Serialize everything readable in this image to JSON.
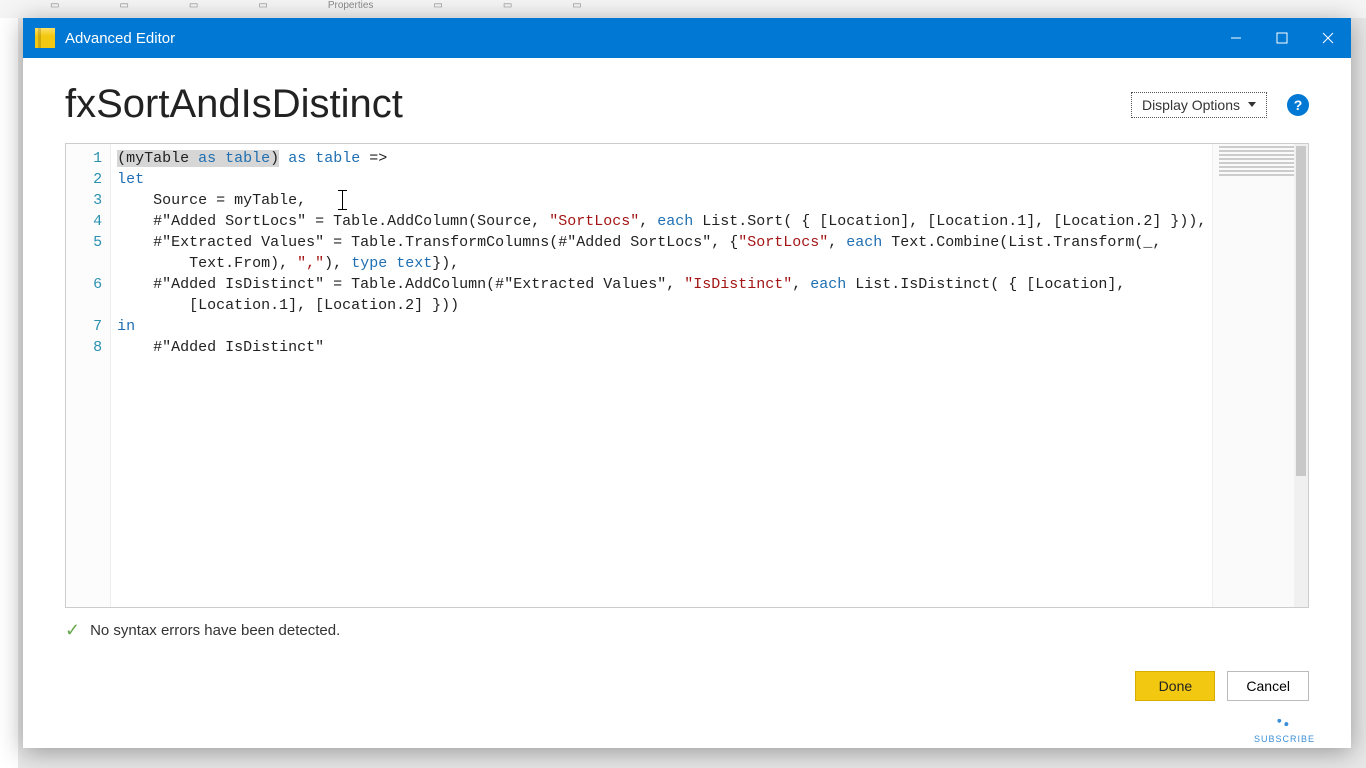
{
  "titlebar": {
    "title": "Advanced Editor"
  },
  "header": {
    "query_name": "fxSortAndIsDistinct",
    "display_options_label": "Display Options"
  },
  "editor": {
    "line_numbers": [
      "1",
      "2",
      "3",
      "4",
      "5",
      "6",
      "7",
      "8"
    ],
    "code": {
      "l1_a": "(myTable ",
      "l1_b": "as",
      "l1_c": " table",
      "l1_d": ")",
      "l1_e": " ",
      "l1_f": "as",
      "l1_g": " table",
      "l1_h": " =>",
      "l2_a": "let",
      "l3": "    Source = myTable,",
      "l4_a": "    #\"Added SortLocs\" = Table.AddColumn(Source, ",
      "l4_b": "\"SortLocs\"",
      "l4_c": ", ",
      "l4_d": "each",
      "l4_e": " List.Sort( { [Location], [Location.1], [Location.2] })),",
      "l5_a": "    #\"Extracted Values\" = Table.TransformColumns(#\"Added SortLocs\", {",
      "l5_b": "\"SortLocs\"",
      "l5_c": ", ",
      "l5_d": "each",
      "l5_e": " Text.Combine(List.Transform(_,",
      "l5f": "        Text.From), ",
      "l5g": "\",\"",
      "l5h": "), ",
      "l5i": "type",
      "l5j": " text",
      "l5k": "}),",
      "l6_a": "    #\"Added IsDistinct\" = Table.AddColumn(#\"Extracted Values\", ",
      "l6_b": "\"IsDistinct\"",
      "l6_c": ", ",
      "l6_d": "each",
      "l6_e": " List.IsDistinct( { [Location],",
      "l6f": "        [Location.1], [Location.2] }))",
      "l7": "in",
      "l8": "    #\"Added IsDistinct\""
    }
  },
  "status": {
    "message": "No syntax errors have been detected."
  },
  "buttons": {
    "done": "Done",
    "cancel": "Cancel"
  },
  "subscribe": "SUBSCRIBE"
}
